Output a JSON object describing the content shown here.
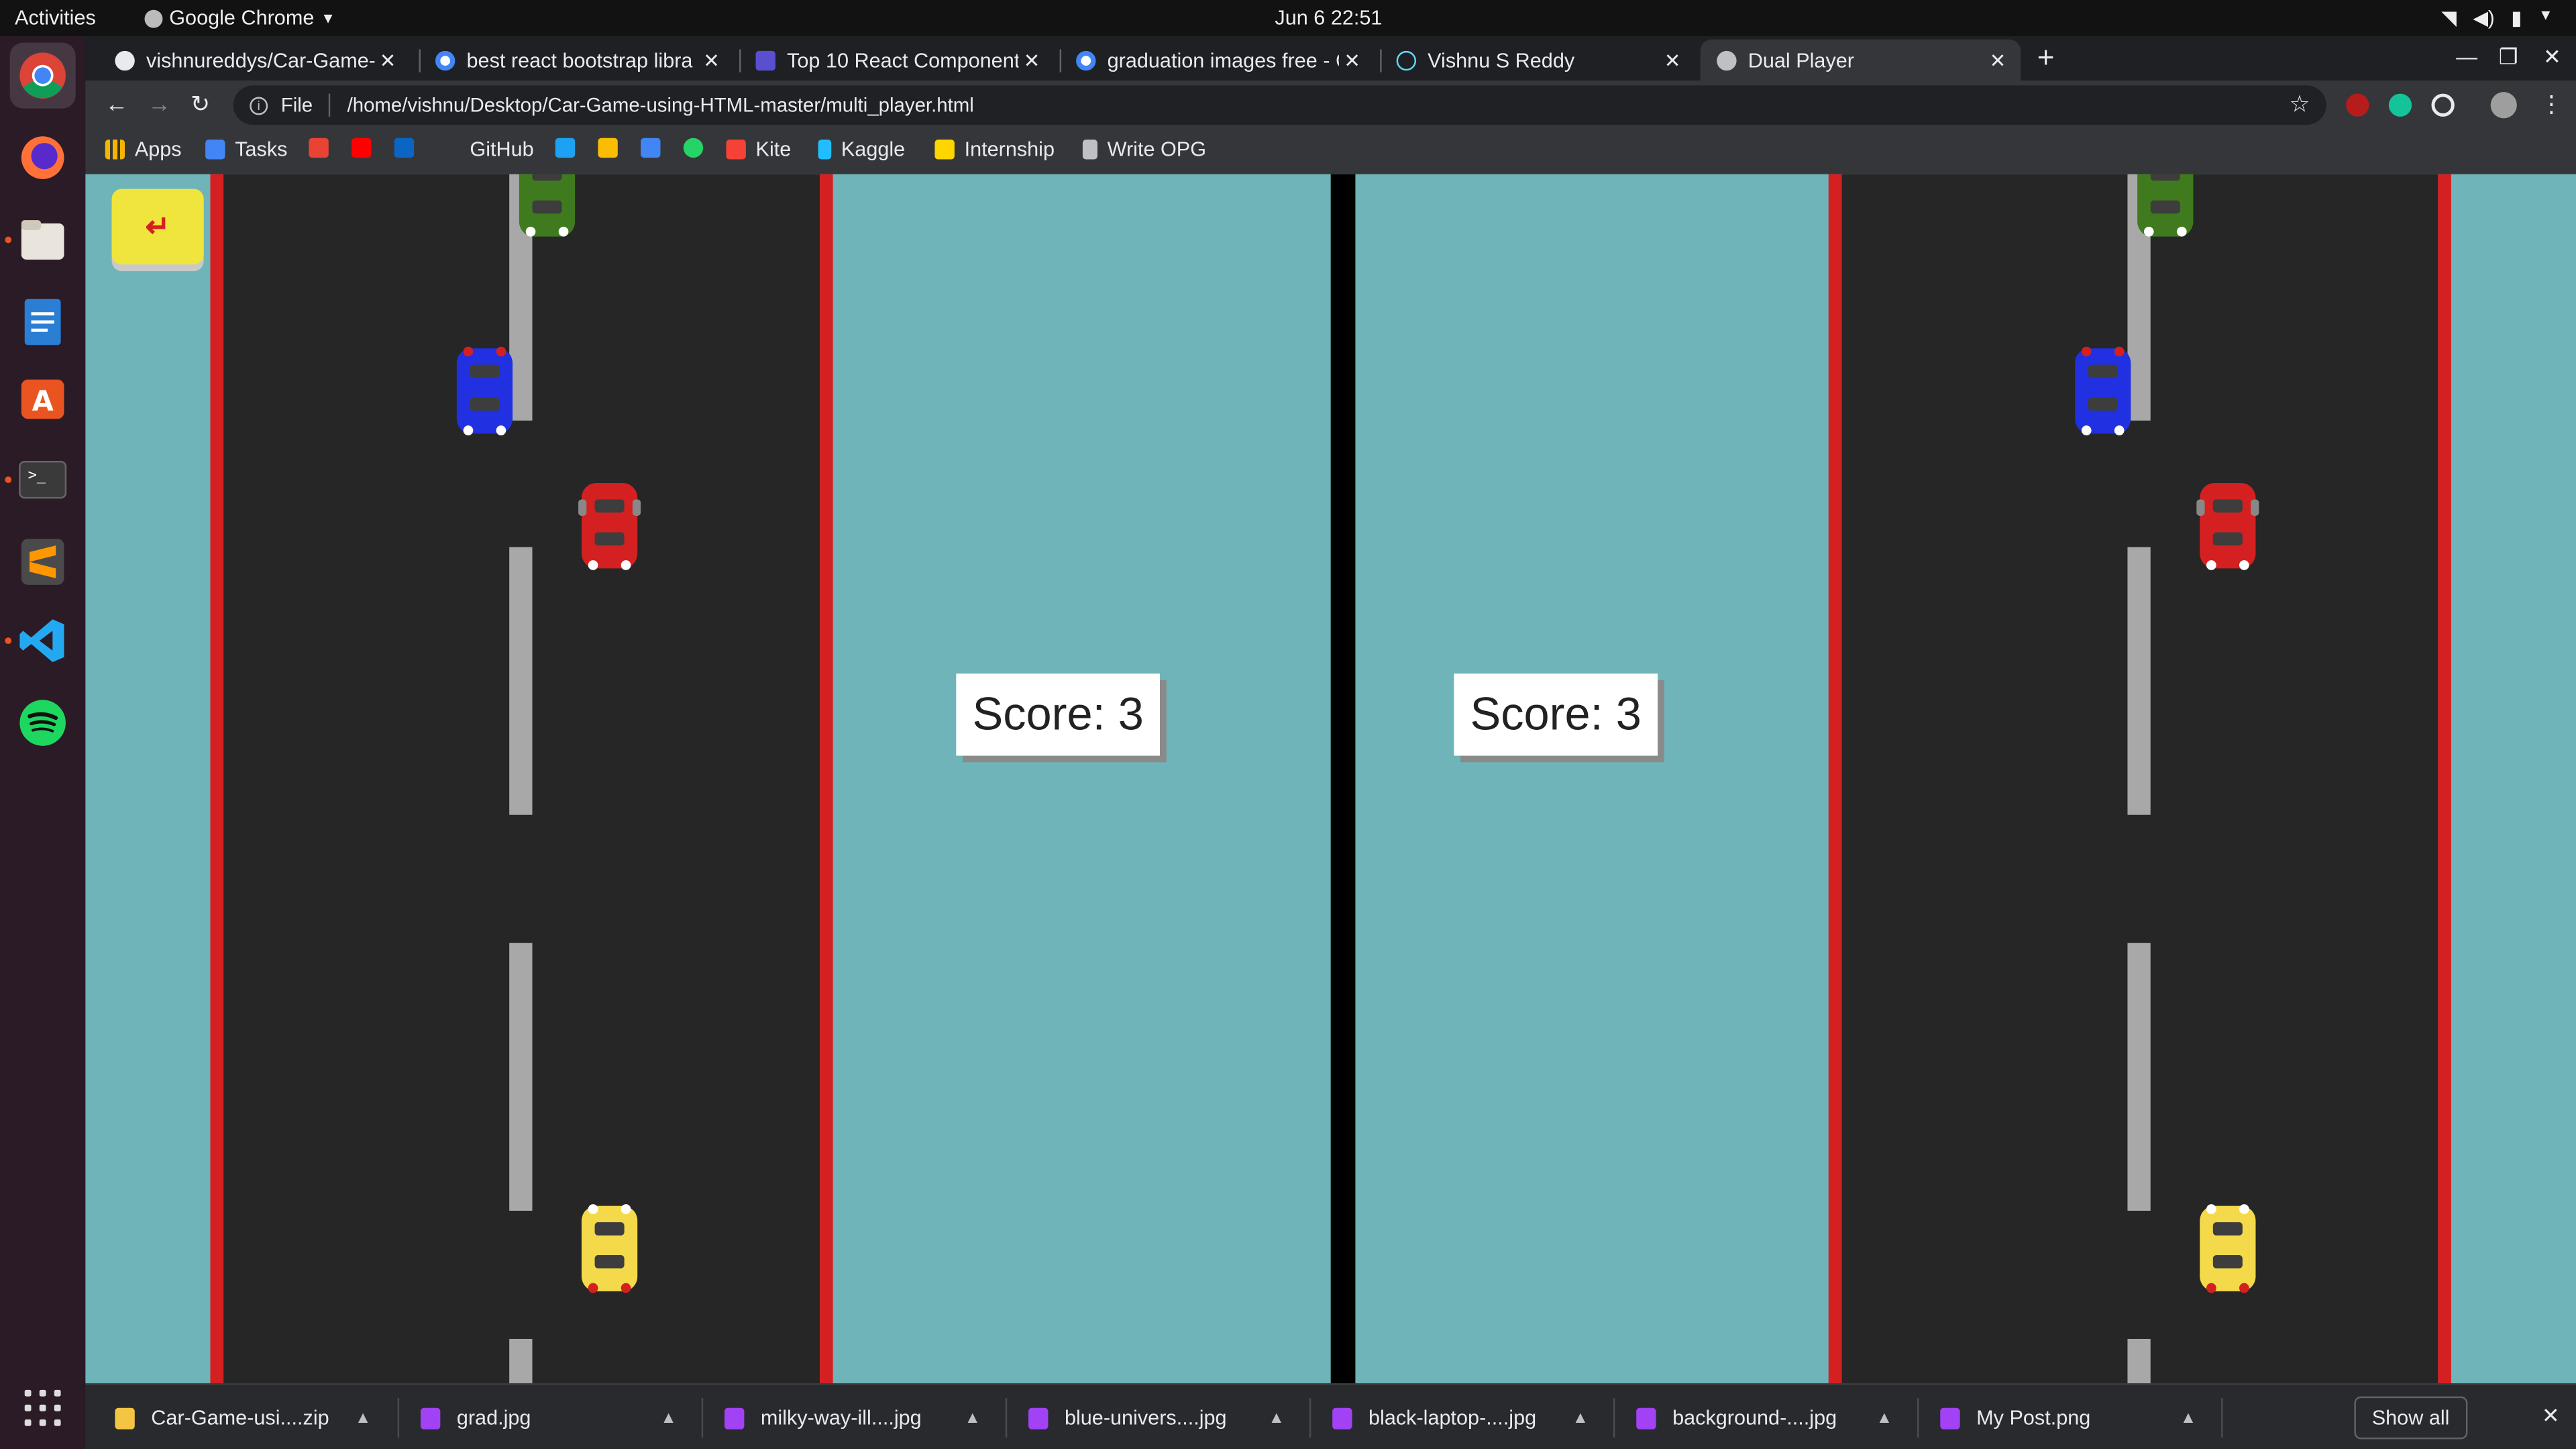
{
  "topbar": {
    "activities": "Activities",
    "app_name": "Google Chrome",
    "clock": "Jun 6  22:51"
  },
  "tabs": [
    {
      "label": "vishnureddys/Car-Game-u",
      "favicon_color": "#e8eaed"
    },
    {
      "label": "best react bootstrap libra",
      "favicon_color": "#ffffff"
    },
    {
      "label": "Top 10 React Component",
      "favicon_color": "#5a4fcf"
    },
    {
      "label": "graduation images free - G",
      "favicon_color": "#ffffff"
    },
    {
      "label": "Vishnu S Reddy",
      "favicon_color": "#61dafb"
    },
    {
      "label": "Dual Player",
      "favicon_color": "#bdc1c6",
      "active": true
    }
  ],
  "toolbar": {
    "scheme": "File",
    "url": "/home/vishnu/Desktop/Car-Game-using-HTML-master/multi_player.html"
  },
  "bookmarks": [
    {
      "label": "Apps",
      "icon": "apps-grid-icon",
      "color": "#f4b400"
    },
    {
      "label": "Tasks",
      "icon": "tasks-icon",
      "color": "#4285f4"
    },
    {
      "label": "",
      "icon": "gmail-icon",
      "color": "#ea4335"
    },
    {
      "label": "",
      "icon": "youtube-icon",
      "color": "#ff0000"
    },
    {
      "label": "",
      "icon": "linkedin-icon",
      "color": "#0a66c2"
    },
    {
      "label": "GitHub",
      "icon": "github-icon",
      "color": "#35363a"
    },
    {
      "label": "",
      "icon": "twitter-icon",
      "color": "#1da1f2"
    },
    {
      "label": "",
      "icon": "drive-icon",
      "color": "#fbbc04"
    },
    {
      "label": "",
      "icon": "docs-icon",
      "color": "#4285f4"
    },
    {
      "label": "",
      "icon": "whatsapp-icon",
      "color": "#25d366"
    },
    {
      "label": "Kite",
      "icon": "kite-icon",
      "color": "#f44336"
    },
    {
      "label": "Kaggle",
      "icon": "kaggle-icon",
      "color": "#20beff"
    },
    {
      "label": "Internship",
      "icon": "internship-icon",
      "color": "#ffd600"
    },
    {
      "label": "Write OPG",
      "icon": "opg-icon",
      "color": "#bdc1c6"
    }
  ],
  "game": {
    "back_button": "↵",
    "player1_score": "Score: 3",
    "player2_score": "Score: 3",
    "colors": {
      "grass": "#6fb4b8",
      "road": "#262626",
      "border": "#d42020",
      "back_button": "#f0e53c"
    },
    "cars": [
      "green",
      "blue",
      "red",
      "yellow"
    ]
  },
  "downloads": [
    {
      "label": "Car-Game-usi....zip",
      "icon_color": "#f4c542"
    },
    {
      "label": "grad.jpg",
      "icon_color": "#a142f4"
    },
    {
      "label": "milky-way-ill....jpg",
      "icon_color": "#a142f4"
    },
    {
      "label": "blue-univers....jpg",
      "icon_color": "#a142f4"
    },
    {
      "label": "black-laptop-....jpg",
      "icon_color": "#a142f4"
    },
    {
      "label": "background-....jpg",
      "icon_color": "#a142f4"
    },
    {
      "label": "My Post.png",
      "icon_color": "#a142f4"
    }
  ],
  "shelf": {
    "show_all": "Show all"
  }
}
